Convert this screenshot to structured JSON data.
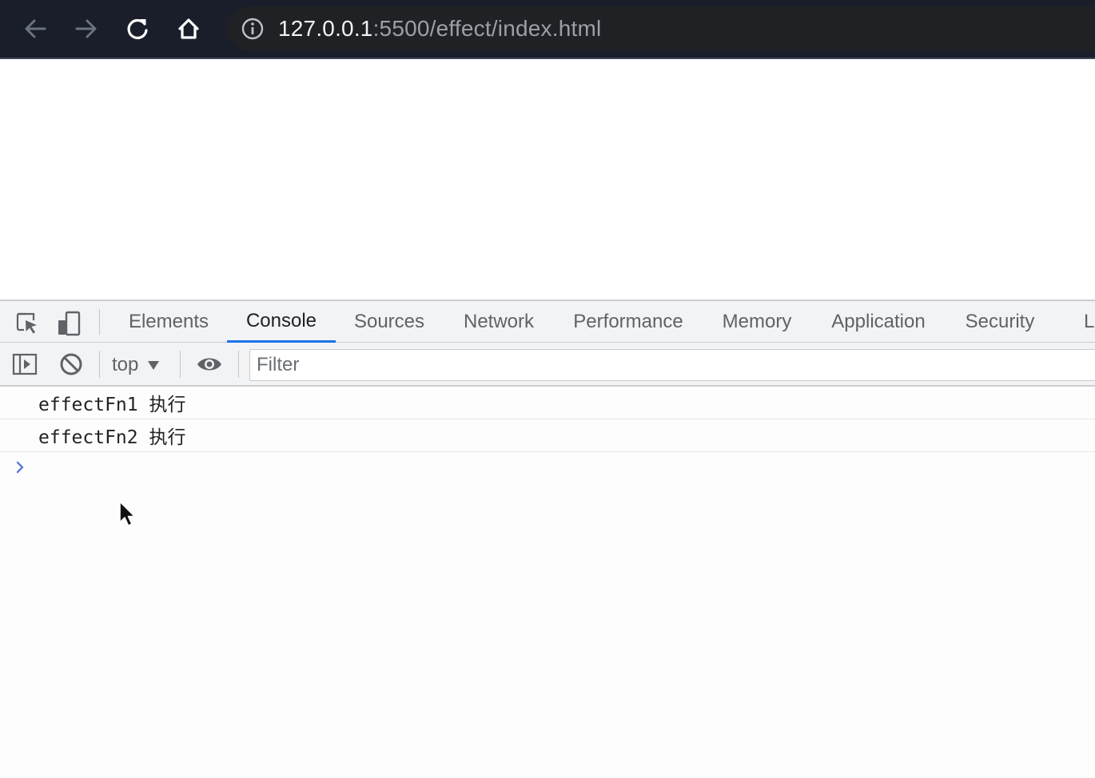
{
  "browser": {
    "url_host": "127.0.0.1",
    "url_path": ":5500/effect/index.html",
    "icons": [
      "back-arrow-icon",
      "forward-arrow-icon",
      "reload-icon",
      "home-icon",
      "info-icon"
    ]
  },
  "devtools": {
    "tabs": [
      {
        "label": "Elements",
        "active": false
      },
      {
        "label": "Console",
        "active": true
      },
      {
        "label": "Sources",
        "active": false
      },
      {
        "label": "Network",
        "active": false
      },
      {
        "label": "Performance",
        "active": false
      },
      {
        "label": "Memory",
        "active": false
      },
      {
        "label": "Application",
        "active": false
      },
      {
        "label": "Security",
        "active": false
      },
      {
        "label": "L",
        "active": false
      }
    ],
    "toolbar": {
      "context": "top",
      "filter_placeholder": "Filter",
      "filter_value": ""
    },
    "console": {
      "logs": [
        "effectFn1 执行",
        "effectFn2 执行"
      ]
    },
    "colors": {
      "accent": "#1a73e8",
      "prompt": "#5b7bd6",
      "browser_bar": "#1a1e2b"
    }
  }
}
